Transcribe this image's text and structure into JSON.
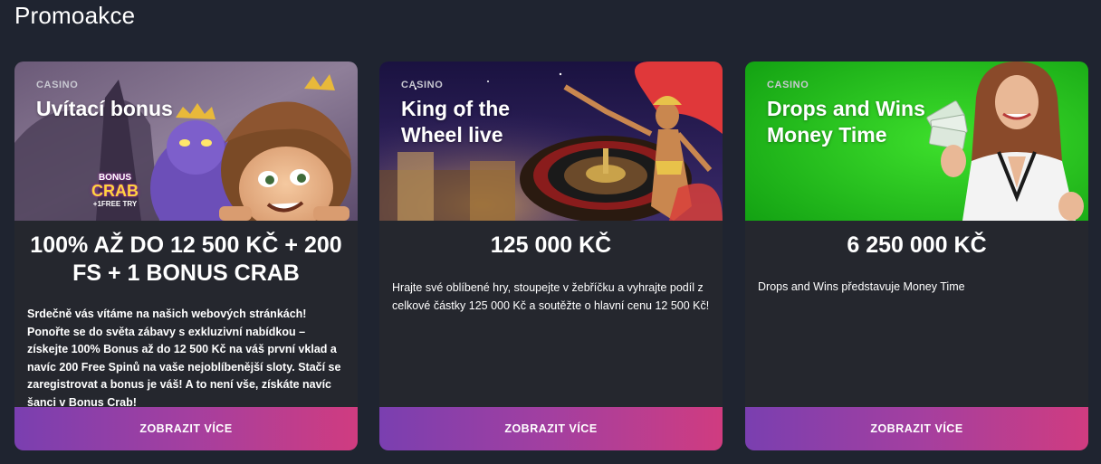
{
  "page": {
    "title": "Promoakce"
  },
  "promos": [
    {
      "category": "CASINO",
      "banner_title": "Uvítací bonus",
      "banner_badge": {
        "top": "BONUS",
        "main": "CRAB",
        "sub": "+1FREE TRY"
      },
      "headline": "100% AŽ DO 12 500 KČ + 200 FS + 1 BONUS CRAB",
      "description": "Srdečně vás vítáme na našich webových stránkách! Ponořte se do světa zábavy s exkluzivní nabídkou – získejte 100% Bonus až do 12 500 Kč na váš první vklad a navíc 200 Free Spinů na vaše nejoblíbenější sloty. Stačí se zaregistrovat a bonus je váš! A to není vše, získáte navíc šanci v Bonus Crab!",
      "cta_label": "ZOBRAZIT VÍCE"
    },
    {
      "category": "CASINO",
      "banner_title": "King of the Wheel live",
      "headline": "125 000 KČ",
      "description": "Hrajte své oblíbené hry, stoupejte v žebříčku a vyhrajte podíl z celkové částky 125 000 Kč a soutěžte o hlavní cenu 12 500 Kč!",
      "cta_label": "ZOBRAZIT VÍCE"
    },
    {
      "category": "CASINO",
      "banner_title": "Drops and Wins Money Time",
      "headline": "6 250 000 KČ",
      "description": "Drops and Wins představuje Money Time",
      "cta_label": "ZOBRAZIT VÍCE"
    }
  ],
  "colors": {
    "page_bg": "#1f2430",
    "card_bg": "#25272e",
    "cta_gradient_start": "#7a3fb0",
    "cta_gradient_end": "#d03c80",
    "green_banner": "#22c21f"
  }
}
